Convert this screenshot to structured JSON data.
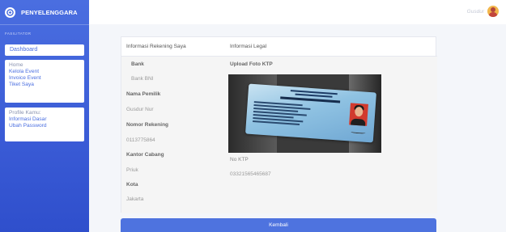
{
  "brand": {
    "name": "PENYELENGGARA"
  },
  "sidebar": {
    "heading": "FASILITATOR",
    "dashboard": "Dashboard",
    "menu": [
      "Home",
      "Kelola Event",
      "Invoice Event",
      "Tiket Saya"
    ],
    "profile": [
      "Profile Kamu:",
      "Informasi Dasar",
      "Ubah Password"
    ]
  },
  "topbar": {
    "user_name": "Gusdur",
    "avatar_icon": "user-avatar"
  },
  "card": {
    "left_header": "Informasi Rekening Saya",
    "right_header": "Informasi Legal",
    "bank_label": "Bank",
    "bank_value": "Bank BNI",
    "owner_label": "Nama Pemilik",
    "owner_value": "Gusdur Nur",
    "account_label": "Nomor Rekening",
    "account_value": "0113775864",
    "branch_label": "Kantor Cabang",
    "branch_value": "Priuk",
    "city_label": "Kota",
    "city_value": "Jakarta",
    "upload_label": "Upload Foto KTP",
    "ktp_label": "No KTP",
    "ktp_value": "03321565465687"
  },
  "button": {
    "back": "Kembali"
  },
  "colors": {
    "primary": "#4e73df",
    "sidebar": "#3a5bd6"
  }
}
